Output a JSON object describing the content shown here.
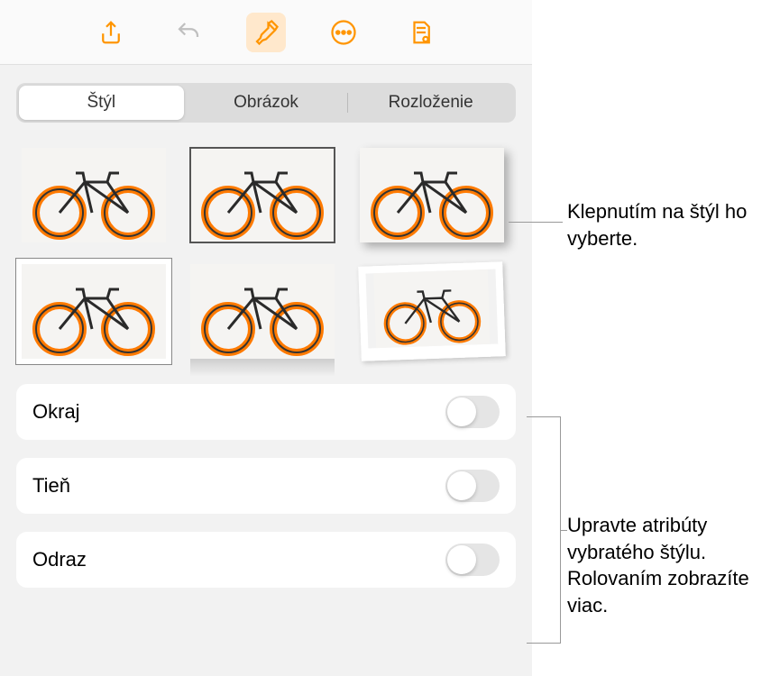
{
  "toolbar": {
    "share": "share-icon",
    "undo": "undo-icon",
    "format": "paintbrush-icon",
    "more": "more-icon",
    "view": "document-view-icon"
  },
  "tabs": {
    "style": "Štýl",
    "image": "Obrázok",
    "layout": "Rozloženie",
    "selected": 0
  },
  "settings": {
    "border": {
      "label": "Okraj",
      "on": false
    },
    "shadow": {
      "label": "Tieň",
      "on": false
    },
    "reflect": {
      "label": "Odraz",
      "on": false
    }
  },
  "callouts": {
    "tap_style": "Klepnutím na štýl ho vyberte.",
    "adjust": "Upravte atribúty vybratého štýlu. Rolovaním zobrazíte viac."
  }
}
